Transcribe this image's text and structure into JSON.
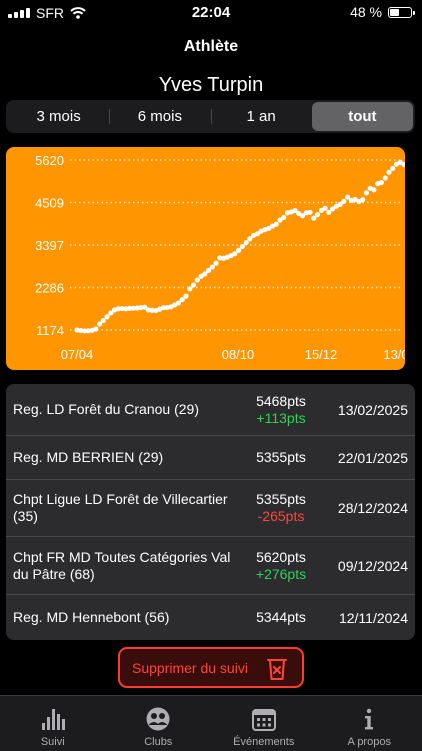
{
  "status": {
    "carrier": "SFR",
    "time": "22:04",
    "battery": "48 %",
    "battery_level": 0.48
  },
  "nav": {
    "title": "Athlète"
  },
  "athlete": {
    "name": "Yves Turpin"
  },
  "segments": [
    {
      "label": "3 mois",
      "active": false
    },
    {
      "label": "6 mois",
      "active": false
    },
    {
      "label": "1 an",
      "active": false
    },
    {
      "label": "tout",
      "active": true
    }
  ],
  "chart_data": {
    "type": "scatter",
    "y_ticks": [
      "5620",
      "4509",
      "3397",
      "2286",
      "1174"
    ],
    "x_ticks": [
      "07/04",
      "08/10",
      "15/12",
      "13/0"
    ],
    "ylim": [
      1174,
      5620
    ],
    "grid": true,
    "series": [
      {
        "values": [
          1174,
          1160,
          1150,
          1155,
          1165,
          1200,
          1330,
          1420,
          1520,
          1620,
          1700,
          1730,
          1735,
          1730,
          1740,
          1745,
          1750,
          1760,
          1770,
          1700,
          1690,
          1680,
          1720,
          1760,
          1760,
          1780,
          1830,
          1880,
          1970,
          2060,
          2250,
          2350,
          2480,
          2580,
          2640,
          2730,
          2820,
          2920,
          3060,
          3050,
          3080,
          3120,
          3170,
          3260,
          3360,
          3460,
          3560,
          3650,
          3690,
          3760,
          3800,
          3830,
          3890,
          3940,
          4050,
          4120,
          4240,
          4260,
          4300,
          4220,
          4160,
          4240,
          4250,
          4100,
          4190,
          4300,
          4360,
          4250,
          4340,
          4410,
          4460,
          4540,
          4650,
          4560,
          4590,
          4530,
          4580,
          4760,
          4880,
          4840,
          5000,
          5030,
          5150,
          5300,
          5400,
          5510,
          5560,
          5500
        ]
      }
    ]
  },
  "results": [
    {
      "name": "Reg. LD Forêt du Cranou (29)",
      "points": "5468pts",
      "delta": "+113pts",
      "delta_sign": "pos",
      "date": "13/02/2025"
    },
    {
      "name": "Reg. MD BERRIEN (29)",
      "points": "5355pts",
      "delta": "",
      "delta_sign": "",
      "date": "22/01/2025"
    },
    {
      "name": "Chpt Ligue LD Forêt de Villecartier (35)",
      "points": "5355pts",
      "delta": "-265pts",
      "delta_sign": "neg",
      "date": "28/12/2024"
    },
    {
      "name": "Chpt FR MD Toutes Catégories Val du Pâtre (68)",
      "points": "5620pts",
      "delta": "+276pts",
      "delta_sign": "pos",
      "date": "09/12/2024"
    },
    {
      "name": "Reg. MD Hennebont (56)",
      "points": "5344pts",
      "delta": "",
      "delta_sign": "",
      "date": "12/11/2024"
    }
  ],
  "actions": {
    "delete_label": "Supprimer du suivi"
  },
  "tabs": [
    {
      "label": "Suivi",
      "icon": "chart-bars-icon",
      "active": true
    },
    {
      "label": "Clubs",
      "icon": "group-icon",
      "active": false
    },
    {
      "label": "Événements",
      "icon": "calendar-icon",
      "active": false
    },
    {
      "label": "A propos",
      "icon": "info-icon",
      "active": false
    }
  ],
  "colors": {
    "chart_bg": "#ff9500",
    "positive": "#30d158",
    "negative": "#ff453a",
    "danger": "#ff3b30"
  }
}
